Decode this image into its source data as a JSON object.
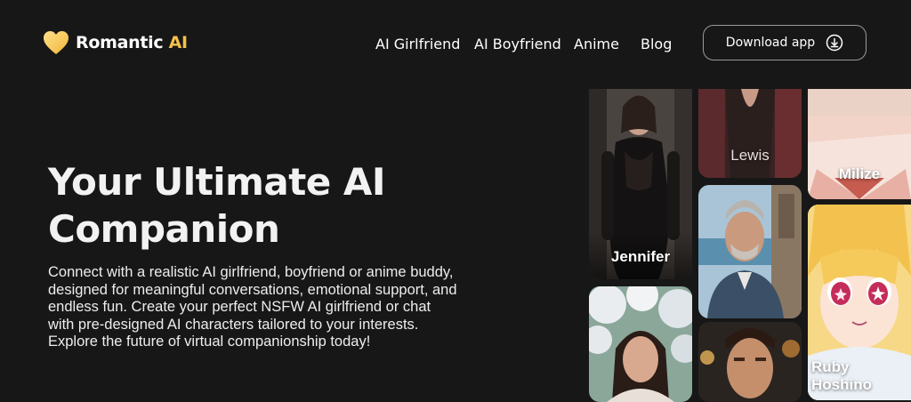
{
  "brand": {
    "name": "Romantic",
    "accent": "AI",
    "accent_color": "#f5c04a"
  },
  "nav": {
    "items": [
      "AI Girlfriend",
      "AI Boyfriend",
      "Anime",
      "Blog"
    ],
    "download_label": "Download app"
  },
  "hero": {
    "title_line1": "Your Ultimate AI",
    "title_line2": "Companion",
    "description": "Connect with a realistic AI girlfriend, boyfriend or anime buddy, designed for meaningful conversations, emotional support, and endless fun. Create your perfect NSFW AI girlfriend or chat with pre-designed AI characters tailored to your interests. Explore the future of virtual companionship today!"
  },
  "cards": {
    "jennifer": "Jennifer",
    "lewis": "Lewis",
    "milize": "Milize",
    "ruby": "Ruby Hoshino"
  }
}
